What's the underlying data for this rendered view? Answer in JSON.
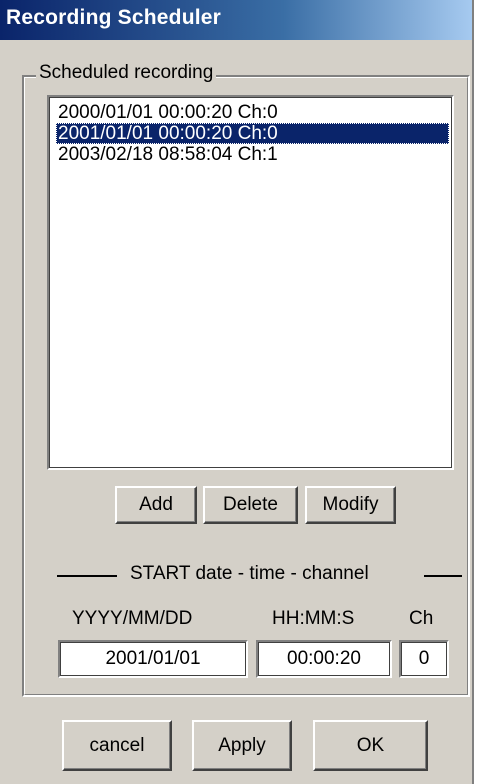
{
  "window": {
    "title": "Recording Scheduler"
  },
  "group": {
    "label": "Scheduled recording"
  },
  "list": {
    "items": [
      {
        "text": "2000/01/01 00:00:20 Ch:0",
        "selected": false
      },
      {
        "text": "2001/01/01 00:00:20 Ch:0",
        "selected": true
      },
      {
        "text": "2003/02/18 08:58:04 Ch:1",
        "selected": false
      }
    ]
  },
  "buttons": {
    "add": "Add",
    "delete": "Delete",
    "modify": "Modify"
  },
  "section": {
    "label": "START date - time - channel"
  },
  "fields": {
    "date": {
      "label": "YYYY/MM/DD",
      "value": "2001/01/01"
    },
    "time": {
      "label": "HH:MM:S",
      "value": "00:00:20"
    },
    "channel": {
      "label": "Ch",
      "value": "0"
    }
  },
  "footer": {
    "cancel": "cancel",
    "apply": "Apply",
    "ok": "OK"
  },
  "colors": {
    "title_bar": "#0a246a",
    "selection": "#0a246a",
    "face": "#d4d0c8"
  }
}
